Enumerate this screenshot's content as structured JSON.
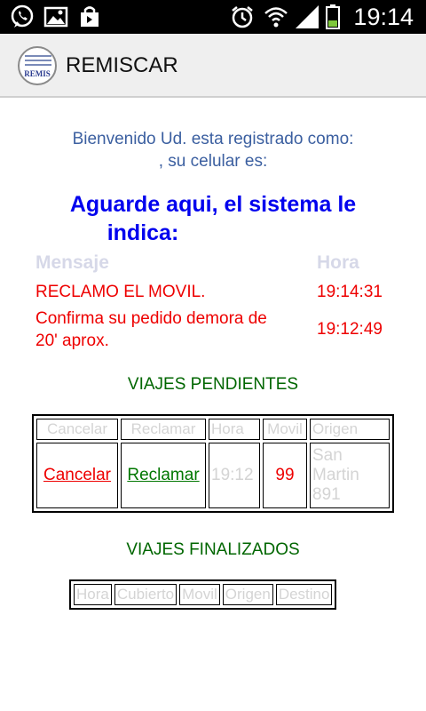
{
  "status_bar": {
    "time": "19:14",
    "icons": [
      "whatsapp-icon",
      "gallery-icon",
      "shopping-bag-icon",
      "alarm-icon",
      "wifi-icon",
      "signal-icon",
      "battery-icon"
    ]
  },
  "action_bar": {
    "logo_text": "REMIS",
    "title": "REMISCAR"
  },
  "welcome": {
    "line1": "Bienvenido Ud. esta registrado como:",
    "line2": ", su celular es:"
  },
  "wait_message": {
    "line1": "Aguarde aqui, el sistema le",
    "line2": "indica:"
  },
  "messages": {
    "header_message": "Mensaje",
    "header_time": "Hora",
    "rows": [
      {
        "text1": "RECLAMO EL MOVIL.",
        "text2": "",
        "time": "19:14:31"
      },
      {
        "text1": "Confirma su pedido demora de",
        "text2": "20' aprox.",
        "time": "19:12:49"
      }
    ]
  },
  "pending": {
    "title": "VIAJES PENDIENTES",
    "headers": [
      "Cancelar",
      "Reclamar",
      "Hora",
      "Movil",
      "Origen"
    ],
    "rows": [
      {
        "cancel": "Cancelar",
        "claim": "Reclamar",
        "time": "19:12",
        "movil": "99",
        "origin_line1": "San",
        "origin_line2": "Martin",
        "origin_line3": "891"
      }
    ]
  },
  "finished": {
    "title": "VIAJES FINALIZADOS",
    "headers": [
      "Hora",
      "Cubierto",
      "Movil",
      "Origen",
      "Destino"
    ]
  },
  "colors": {
    "accent_blue": "#0000ee",
    "welcome_blue": "#3b5fa0",
    "alert_red": "#ee0000",
    "section_green": "#006600"
  }
}
